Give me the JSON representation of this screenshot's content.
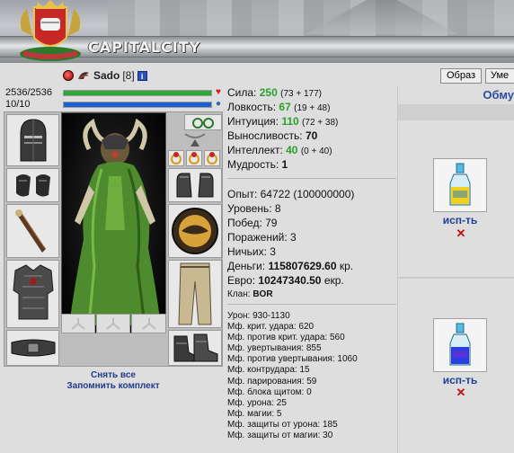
{
  "header": {
    "logo_text": "CAPITALCITY",
    "buttons": [
      "Образ",
      "Уме"
    ]
  },
  "character": {
    "name": "Sado",
    "level": "[8]",
    "info_badge": "i",
    "hp": "2536/2536",
    "hp_fraction": 1.0,
    "mana": "10/10",
    "mana_fraction": 1.0,
    "colors": {
      "hp": "#2ea836",
      "mana": "#1d5fd6",
      "heart": "#d11",
      "mana_dot": "#1e63d8"
    }
  },
  "equipment": {
    "actions": [
      "Снять все",
      "Запомнить комплект"
    ]
  },
  "stats": {
    "strength": {
      "label": "Сила:",
      "value": "250",
      "detail": "(73 + 177)"
    },
    "agility": {
      "label": "Ловкость:",
      "value": "67",
      "detail": "(19 + 48)"
    },
    "intuition": {
      "label": "Интуиция:",
      "value": "110",
      "detail": "(72 + 38)"
    },
    "endurance": {
      "label": "Выносливость:",
      "value": "70"
    },
    "intellect": {
      "label": "Интеллект:",
      "value": "40",
      "detail": "(0 + 40)"
    },
    "wisdom": {
      "label": "Мудрость:",
      "value": "1"
    }
  },
  "progress": {
    "experience": "Опыт: 64722 (100000000)",
    "level": "Уровень: 8",
    "wins": "Побед: 79",
    "losses": "Поражений: 3",
    "draws": "Ничьих: 3",
    "money_label": "Деньги:",
    "money_value": "115807629.60",
    "money_unit": "кр.",
    "euro_label": "Евро:",
    "euro_value": "10247340.50",
    "euro_unit": "екр.",
    "clan_label": "Клан:",
    "clan_value": "BOR"
  },
  "modifiers": [
    "Урон: 930-1130",
    "Мф. крит. удара: 620",
    "Мф. против крит. удара: 560",
    "Мф. увертывания: 855",
    "Мф. против увертывания: 1060",
    "Мф. контрудара: 15",
    "Мф. парирования: 59",
    "Мф. блока щитом: 0",
    "Мф. урона: 25",
    "Мф. магии: 5",
    "Мф. защиты от урона: 185",
    "Мф. защиты от магии: 30"
  ],
  "right_panel": {
    "heading": "Обму",
    "items": [
      {
        "use_label": "исп-ть",
        "delete_symbol": "✕",
        "liquid_color": "#f0d21a"
      },
      {
        "use_label": "исп-ть",
        "delete_symbol": "✕",
        "liquid_color": "#2a3fe0"
      }
    ]
  }
}
